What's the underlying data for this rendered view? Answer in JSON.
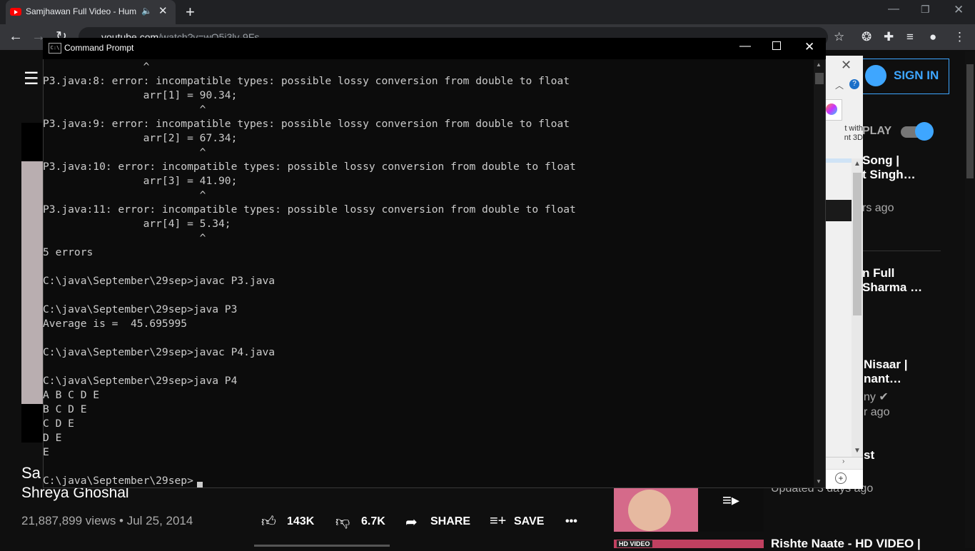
{
  "browser": {
    "tab_title": "Samjhawan Full Video - Hum",
    "new_tab": "+",
    "url_host": "youtube.com",
    "url_path": "/watch?v=wO5i3lv-9Fs"
  },
  "youtube": {
    "sign_in": "SIGN IN",
    "autoplay": "PLAY",
    "video_title_line1": "Sa",
    "video_title_line2": "Shreya Ghoshal",
    "views": "21,887,899 views • Jul 25, 2014",
    "likes": "143K",
    "dislikes": "6.7K",
    "share": "SHARE",
    "save": "SAVE",
    "more": "•••",
    "recommendations": [
      {
        "title1": "Song |",
        "title2": "t Singh…",
        "meta": "rs ago"
      },
      {
        "title1": "n Full",
        "title2": "Sharma …"
      },
      {
        "title1": "Nisaar |",
        "title2": "nant…",
        "channel": "ny ✔",
        "meta": "r ago"
      },
      {
        "title1": "st",
        "meta": "Updated 3 days ago"
      },
      {
        "title1": "Rishte Naate - HD VIDEO |",
        "thumb_badge": "HD VIDEO"
      }
    ]
  },
  "paint_popup": {
    "text": "t with\nnt 3D",
    "help": "?"
  },
  "cmd": {
    "title": "Command Prompt",
    "icon_text": "C:\\",
    "output": "                ^\nP3.java:8: error: incompatible types: possible lossy conversion from double to float\n                arr[1] = 90.34;\n                         ^\nP3.java:9: error: incompatible types: possible lossy conversion from double to float\n                arr[2] = 67.34;\n                         ^\nP3.java:10: error: incompatible types: possible lossy conversion from double to float\n                arr[3] = 41.90;\n                         ^\nP3.java:11: error: incompatible types: possible lossy conversion from double to float\n                arr[4] = 5.34;\n                         ^\n5 errors\n\nC:\\java\\September\\29sep>javac P3.java\n\nC:\\java\\September\\29sep>java P3\nAverage is =  45.695995\n\nC:\\java\\September\\29sep>javac P4.java\n\nC:\\java\\September\\29sep>java P4\nA B C D E\nB C D E\nC D E\nD E\nE\n\nC:\\java\\September\\29sep>"
  }
}
